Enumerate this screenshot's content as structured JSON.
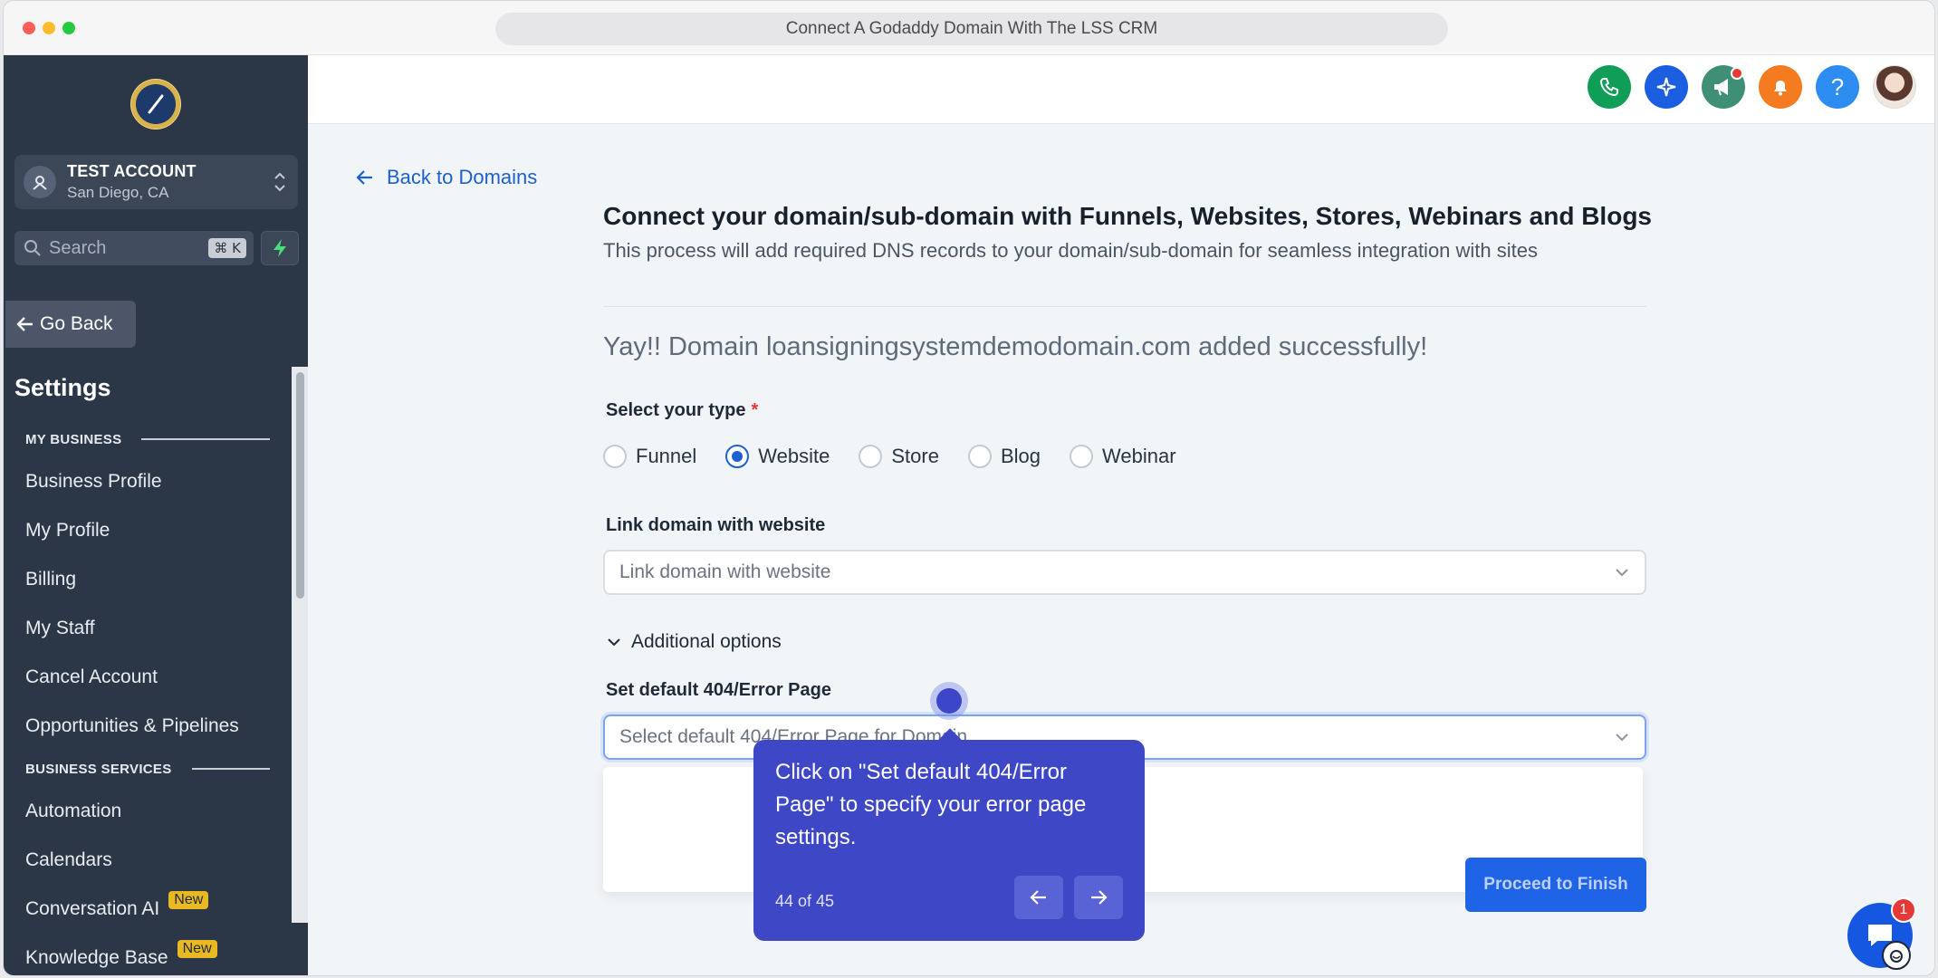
{
  "browser": {
    "url_title": "Connect A Godaddy Domain With The LSS CRM"
  },
  "account": {
    "name": "TEST ACCOUNT",
    "location": "San Diego, CA"
  },
  "search": {
    "placeholder": "Search",
    "shortcut": "⌘ K"
  },
  "sidebar": {
    "go_back": "Go Back",
    "title": "Settings",
    "sections": [
      {
        "label": "MY BUSINESS",
        "items": [
          "Business Profile",
          "My Profile",
          "Billing",
          "My Staff",
          "Cancel Account",
          "Opportunities & Pipelines"
        ]
      },
      {
        "label": "BUSINESS SERVICES",
        "items": [
          "Automation",
          "Calendars",
          "Conversation AI",
          "Knowledge Base"
        ]
      }
    ],
    "badges": {
      "conversation_ai": "New",
      "knowledge_base": "New"
    }
  },
  "header": {
    "help_label": "?"
  },
  "main": {
    "back_link": "Back to Domains",
    "title": "Connect your domain/sub-domain with Funnels, Websites, Stores, Webinars and Blogs",
    "subtitle": "This process will add required DNS records to your domain/sub-domain for seamless integration with sites",
    "success_message": "Yay!! Domain loansigningsystemdemodomain.com added successfully!",
    "type_label": "Select your type",
    "required_mark": "*",
    "types": [
      "Funnel",
      "Website",
      "Store",
      "Blog",
      "Webinar"
    ],
    "selected_type": "Website",
    "link_label": "Link domain with website",
    "link_placeholder": "Link domain with website",
    "additional_options": "Additional options",
    "error_page_label": "Set default 404/Error Page",
    "error_page_placeholder": "Select default 404/Error Page for Domain",
    "proceed_button": "Proceed to Finish"
  },
  "tooltip": {
    "text": "Click on \"Set default 404/Error Page\" to specify your error page settings.",
    "step": "44 of 45"
  },
  "chat": {
    "badge_count": "1"
  },
  "colors": {
    "sidebar_bg": "#2b3647",
    "primary": "#1b5fd1",
    "tooltip_bg": "#3e47c6",
    "badge_new": "#e8b923"
  }
}
